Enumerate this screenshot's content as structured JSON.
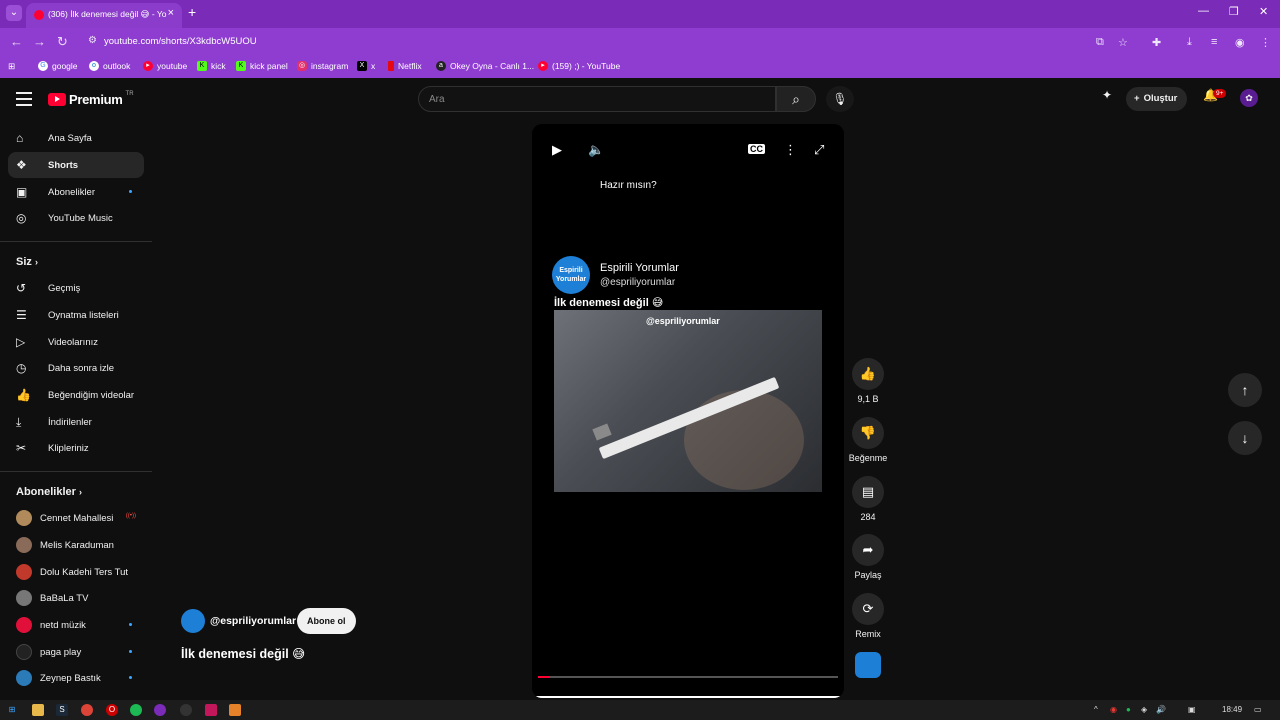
{
  "browser": {
    "tab_title": "(306) İlk denemesi değil 😅 - Yo",
    "tab_close": "×",
    "new_tab": "+",
    "url": "youtube.com/shorts/X3kdbcW5UOU",
    "window_controls": [
      "—",
      "❐",
      "✕"
    ]
  },
  "bookmarks": [
    {
      "label": "google",
      "icon": "google-icon",
      "color": "#ffffff"
    },
    {
      "label": "outlook",
      "icon": "outlook-icon",
      "color": "#ffffff"
    },
    {
      "label": "youtube",
      "icon": "youtube-icon",
      "color": "#ff0033"
    },
    {
      "label": "kick",
      "icon": "kick-icon",
      "color": "#53fc18"
    },
    {
      "label": "kick panel",
      "icon": "kick-icon",
      "color": "#53fc18"
    },
    {
      "label": "instagram",
      "icon": "instagram-icon",
      "color": "#e1306c"
    },
    {
      "label": "x",
      "icon": "x-icon",
      "color": "#000000"
    },
    {
      "label": "Netflix",
      "icon": "netflix-icon",
      "color": "#e50914"
    },
    {
      "label": "Okey Oyna - Canlı 1...",
      "icon": "okey-icon",
      "color": "#222222"
    },
    {
      "label": "(159) ;) - YouTube",
      "icon": "youtube-icon",
      "color": "#ff0033"
    }
  ],
  "header": {
    "logo_text": "Premium",
    "logo_region": "TR",
    "search_placeholder": "Ara",
    "create_label": "Oluştur",
    "notification_count": "9+"
  },
  "sidebar": {
    "main": [
      {
        "label": "Ana Sayfa",
        "icon": "home-icon",
        "glyph": "⌂"
      },
      {
        "label": "Shorts",
        "icon": "shorts-icon",
        "glyph": "❖"
      },
      {
        "label": "Abonelikler",
        "icon": "subscriptions-icon",
        "glyph": "▣"
      },
      {
        "label": "YouTube Music",
        "icon": "music-icon",
        "glyph": "◎"
      }
    ],
    "you_heading": "Siz",
    "you": [
      {
        "label": "Geçmiş",
        "icon": "history-icon",
        "glyph": "↺"
      },
      {
        "label": "Oynatma listeleri",
        "icon": "playlists-icon",
        "glyph": "☰"
      },
      {
        "label": "Videolarınız",
        "icon": "your-videos-icon",
        "glyph": "▷"
      },
      {
        "label": "Daha sonra izle",
        "icon": "watch-later-icon",
        "glyph": "◷"
      },
      {
        "label": "Beğendiğim videolar",
        "icon": "liked-icon",
        "glyph": "👍"
      },
      {
        "label": "İndirilenler",
        "icon": "downloads-icon",
        "glyph": "⤓"
      },
      {
        "label": "Klipleriniz",
        "icon": "clips-icon",
        "glyph": "✂"
      }
    ],
    "subs_heading": "Abonelikler",
    "subscriptions": [
      {
        "label": "Cennet Mahallesi",
        "color": "#b08a5a"
      },
      {
        "label": "Melis Karaduman",
        "color": "#8a6a58"
      },
      {
        "label": "Dolu Kadehi Ters Tut",
        "color": "#c0392b"
      },
      {
        "label": "BaBaLa TV",
        "color": "#777777"
      },
      {
        "label": "netd müzik",
        "color": "#e0103a"
      },
      {
        "label": "paga play",
        "color": "#222222"
      },
      {
        "label": "Zeynep Bastık",
        "color": "#2a7bb8"
      }
    ]
  },
  "player": {
    "overlay_text": "Hazır mısın?",
    "channel_name": "Espirili Yorumlar",
    "channel_handle": "@espriliyorumlar",
    "caption": "İlk denemesi değil 😅",
    "watermark": "@espriliyorumlar",
    "logo_text": "Espirili Yorumlar",
    "progress": 0.04
  },
  "actions": {
    "like_count": "9,1 B",
    "dislike_label": "Beğenme",
    "comment_count": "284",
    "share_label": "Paylaş",
    "remix_label": "Remix"
  },
  "info": {
    "handle": "@espriliyorumlar",
    "subscribe_label": "Abone ol",
    "caption": "İlk denemesi değil 😅"
  },
  "taskbar": {
    "time": "18:49"
  }
}
